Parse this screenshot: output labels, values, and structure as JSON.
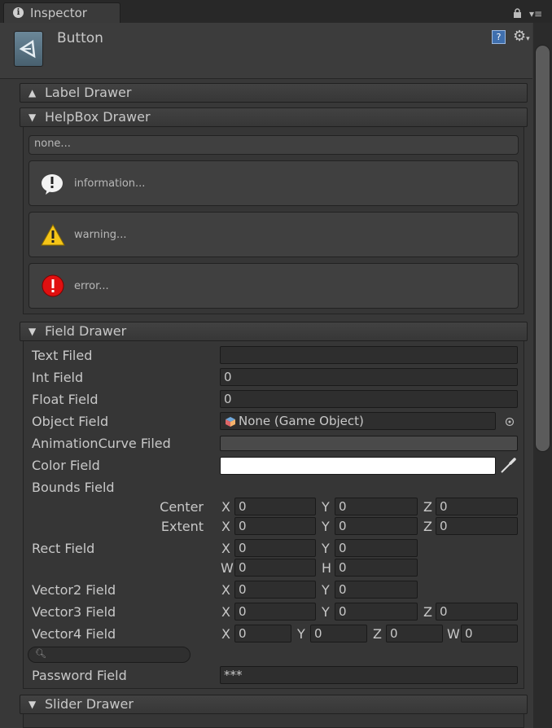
{
  "tab": {
    "label": "Inspector"
  },
  "header": {
    "title": "Button"
  },
  "sections": {
    "label_drawer": "Label Drawer",
    "helpbox_drawer": "HelpBox Drawer",
    "field_drawer": "Field Drawer",
    "slider_drawer": "Slider Drawer"
  },
  "helpboxes": {
    "none": "none...",
    "info": "information...",
    "warning": "warning...",
    "error": "error..."
  },
  "fields": {
    "text_label": "Text Filed",
    "text_value": "",
    "int_label": "Int Field",
    "int_value": "0",
    "float_label": "Float Field",
    "float_value": "0",
    "object_label": "Object Field",
    "object_value": "None (Game Object)",
    "curve_label": "AnimationCurve Filed",
    "color_label": "Color Field",
    "color_value": "#ffffff",
    "bounds_label": "Bounds Field",
    "center_label": "Center",
    "extent_label": "Extent",
    "rect_label": "Rect Field",
    "vector2_label": "Vector2 Field",
    "vector3_label": "Vector3 Field",
    "vector4_label": "Vector4 Field",
    "search_value": "",
    "password_label": "Password Field",
    "password_value": "***"
  },
  "axes": {
    "x": "X",
    "y": "Y",
    "z": "Z",
    "w": "W",
    "h": "H"
  },
  "values": {
    "zero": "0"
  },
  "icons": {
    "tab": "info-icon",
    "lock": "lock-icon",
    "menu": "menu-icon",
    "component": "unity-logo-icon",
    "help": "help-book-icon",
    "gear": "gear-icon",
    "info": "info-icon",
    "warning": "warning-icon",
    "error": "error-icon",
    "object": "gameobject-cube-icon",
    "object_picker": "object-picker-icon",
    "eyedropper": "eyedropper-icon",
    "search": "search-icon"
  }
}
